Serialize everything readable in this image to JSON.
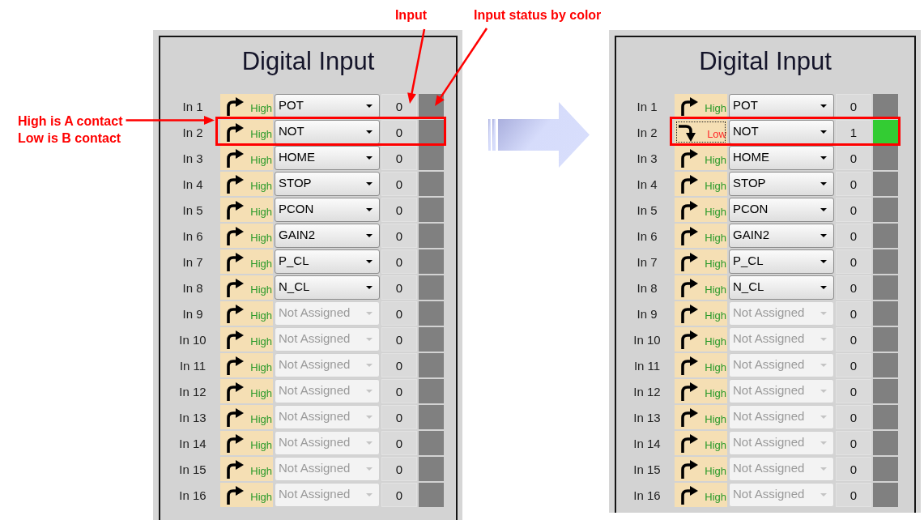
{
  "annotations": {
    "input": "Input",
    "status": "Input status by color",
    "contact_note": [
      "High is A contact",
      "Low is B contact"
    ]
  },
  "panels": [
    {
      "title": "Digital Input",
      "rows": [
        {
          "label": "In 1",
          "polarity": "High",
          "kind": "high",
          "focused": false,
          "function": "POT",
          "disabled": false,
          "value": "0",
          "color": "#808080",
          "highlighted": false
        },
        {
          "label": "In 2",
          "polarity": "High",
          "kind": "high",
          "focused": false,
          "function": "NOT",
          "disabled": false,
          "value": "0",
          "color": "#808080",
          "highlighted": true
        },
        {
          "label": "In 3",
          "polarity": "High",
          "kind": "high",
          "focused": false,
          "function": "HOME",
          "disabled": false,
          "value": "0",
          "color": "#808080",
          "highlighted": false
        },
        {
          "label": "In 4",
          "polarity": "High",
          "kind": "high",
          "focused": false,
          "function": "STOP",
          "disabled": false,
          "value": "0",
          "color": "#808080",
          "highlighted": false
        },
        {
          "label": "In 5",
          "polarity": "High",
          "kind": "high",
          "focused": false,
          "function": "PCON",
          "disabled": false,
          "value": "0",
          "color": "#808080",
          "highlighted": false
        },
        {
          "label": "In 6",
          "polarity": "High",
          "kind": "high",
          "focused": false,
          "function": "GAIN2",
          "disabled": false,
          "value": "0",
          "color": "#808080",
          "highlighted": false
        },
        {
          "label": "In 7",
          "polarity": "High",
          "kind": "high",
          "focused": false,
          "function": "P_CL",
          "disabled": false,
          "value": "0",
          "color": "#808080",
          "highlighted": false
        },
        {
          "label": "In 8",
          "polarity": "High",
          "kind": "high",
          "focused": false,
          "function": "N_CL",
          "disabled": false,
          "value": "0",
          "color": "#808080",
          "highlighted": false
        },
        {
          "label": "In 9",
          "polarity": "High",
          "kind": "high",
          "focused": false,
          "function": "Not Assigned",
          "disabled": true,
          "value": "0",
          "color": "#808080",
          "highlighted": false
        },
        {
          "label": "In 10",
          "polarity": "High",
          "kind": "high",
          "focused": false,
          "function": "Not Assigned",
          "disabled": true,
          "value": "0",
          "color": "#808080",
          "highlighted": false
        },
        {
          "label": "In 11",
          "polarity": "High",
          "kind": "high",
          "focused": false,
          "function": "Not Assigned",
          "disabled": true,
          "value": "0",
          "color": "#808080",
          "highlighted": false
        },
        {
          "label": "In 12",
          "polarity": "High",
          "kind": "high",
          "focused": false,
          "function": "Not Assigned",
          "disabled": true,
          "value": "0",
          "color": "#808080",
          "highlighted": false
        },
        {
          "label": "In 13",
          "polarity": "High",
          "kind": "high",
          "focused": false,
          "function": "Not Assigned",
          "disabled": true,
          "value": "0",
          "color": "#808080",
          "highlighted": false
        },
        {
          "label": "In 14",
          "polarity": "High",
          "kind": "high",
          "focused": false,
          "function": "Not Assigned",
          "disabled": true,
          "value": "0",
          "color": "#808080",
          "highlighted": false
        },
        {
          "label": "In 15",
          "polarity": "High",
          "kind": "high",
          "focused": false,
          "function": "Not Assigned",
          "disabled": true,
          "value": "0",
          "color": "#808080",
          "highlighted": false
        },
        {
          "label": "In 16",
          "polarity": "High",
          "kind": "high",
          "focused": false,
          "function": "Not Assigned",
          "disabled": true,
          "value": "0",
          "color": "#808080",
          "highlighted": false
        }
      ]
    },
    {
      "title": "Digital Input",
      "rows": [
        {
          "label": "In 1",
          "polarity": "High",
          "kind": "high",
          "focused": false,
          "function": "POT",
          "disabled": false,
          "value": "0",
          "color": "#808080",
          "highlighted": false
        },
        {
          "label": "In 2",
          "polarity": "Low",
          "kind": "low",
          "focused": true,
          "function": "NOT",
          "disabled": false,
          "value": "1",
          "color": "#33cc33",
          "highlighted": true
        },
        {
          "label": "In 3",
          "polarity": "High",
          "kind": "high",
          "focused": false,
          "function": "HOME",
          "disabled": false,
          "value": "0",
          "color": "#808080",
          "highlighted": false
        },
        {
          "label": "In 4",
          "polarity": "High",
          "kind": "high",
          "focused": false,
          "function": "STOP",
          "disabled": false,
          "value": "0",
          "color": "#808080",
          "highlighted": false
        },
        {
          "label": "In 5",
          "polarity": "High",
          "kind": "high",
          "focused": false,
          "function": "PCON",
          "disabled": false,
          "value": "0",
          "color": "#808080",
          "highlighted": false
        },
        {
          "label": "In 6",
          "polarity": "High",
          "kind": "high",
          "focused": false,
          "function": "GAIN2",
          "disabled": false,
          "value": "0",
          "color": "#808080",
          "highlighted": false
        },
        {
          "label": "In 7",
          "polarity": "High",
          "kind": "high",
          "focused": false,
          "function": "P_CL",
          "disabled": false,
          "value": "0",
          "color": "#808080",
          "highlighted": false
        },
        {
          "label": "In 8",
          "polarity": "High",
          "kind": "high",
          "focused": false,
          "function": "N_CL",
          "disabled": false,
          "value": "0",
          "color": "#808080",
          "highlighted": false
        },
        {
          "label": "In 9",
          "polarity": "High",
          "kind": "high",
          "focused": false,
          "function": "Not Assigned",
          "disabled": true,
          "value": "0",
          "color": "#808080",
          "highlighted": false
        },
        {
          "label": "In 10",
          "polarity": "High",
          "kind": "high",
          "focused": false,
          "function": "Not Assigned",
          "disabled": true,
          "value": "0",
          "color": "#808080",
          "highlighted": false
        },
        {
          "label": "In 11",
          "polarity": "High",
          "kind": "high",
          "focused": false,
          "function": "Not Assigned",
          "disabled": true,
          "value": "0",
          "color": "#808080",
          "highlighted": false
        },
        {
          "label": "In 12",
          "polarity": "High",
          "kind": "high",
          "focused": false,
          "function": "Not Assigned",
          "disabled": true,
          "value": "0",
          "color": "#808080",
          "highlighted": false
        },
        {
          "label": "In 13",
          "polarity": "High",
          "kind": "high",
          "focused": false,
          "function": "Not Assigned",
          "disabled": true,
          "value": "0",
          "color": "#808080",
          "highlighted": false
        },
        {
          "label": "In 14",
          "polarity": "High",
          "kind": "high",
          "focused": false,
          "function": "Not Assigned",
          "disabled": true,
          "value": "0",
          "color": "#808080",
          "highlighted": false
        },
        {
          "label": "In 15",
          "polarity": "High",
          "kind": "high",
          "focused": false,
          "function": "Not Assigned",
          "disabled": true,
          "value": "0",
          "color": "#808080",
          "highlighted": false
        },
        {
          "label": "In 16",
          "polarity": "High",
          "kind": "high",
          "focused": false,
          "function": "Not Assigned",
          "disabled": true,
          "value": "0",
          "color": "#808080",
          "highlighted": false
        }
      ]
    }
  ]
}
